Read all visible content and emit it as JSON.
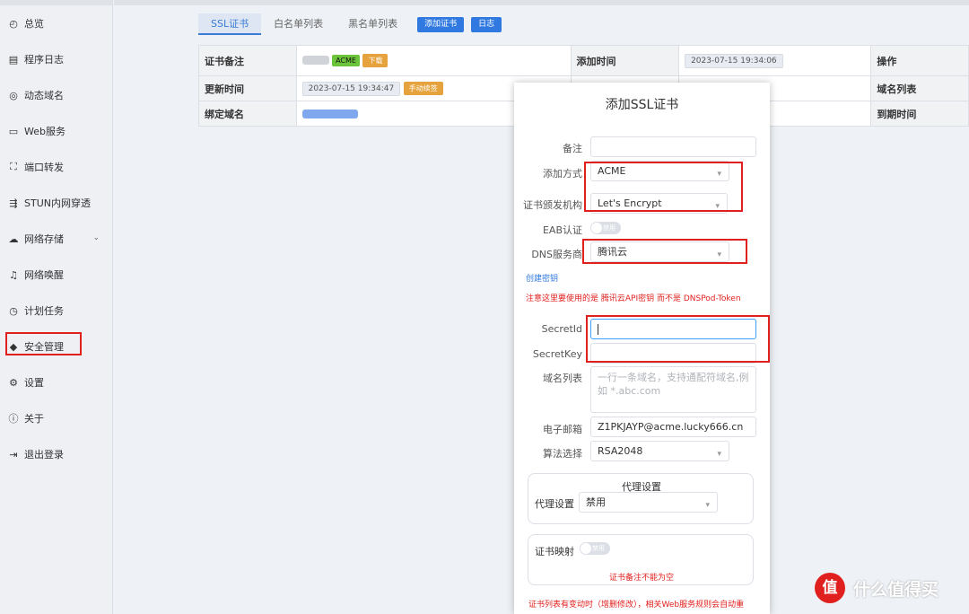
{
  "sidebar": {
    "items": [
      {
        "label": "总览",
        "icon": "dashboard-icon"
      },
      {
        "label": "程序日志",
        "icon": "log-icon"
      },
      {
        "label": "动态域名",
        "icon": "ddns-icon"
      },
      {
        "label": "Web服务",
        "icon": "web-icon"
      },
      {
        "label": "端口转发",
        "icon": "port-forward-icon"
      },
      {
        "label": "STUN内网穿透",
        "icon": "stun-icon"
      },
      {
        "label": "网络存储",
        "icon": "cloud-storage-icon"
      },
      {
        "label": "网络唤醒",
        "icon": "bell-icon"
      },
      {
        "label": "计划任务",
        "icon": "clock-icon"
      },
      {
        "label": "安全管理",
        "icon": "shield-icon"
      },
      {
        "label": "设置",
        "icon": "gear-icon"
      },
      {
        "label": "关于",
        "icon": "info-icon"
      },
      {
        "label": "退出登录",
        "icon": "logout-icon"
      }
    ]
  },
  "tabs": {
    "ssl": "SSL证书",
    "whitelist": "白名单列表",
    "blacklist": "黑名单列表",
    "add_cert": "添加证书",
    "log": "日志"
  },
  "table": {
    "remark_label": "证书备注",
    "acme_tag": "ACME",
    "download_tag": "下载",
    "add_time_label": "添加时间",
    "add_time_value": "2023-07-15 19:34:06",
    "action_label": "操作",
    "update_time_label": "更新时间",
    "update_time_value": "2023-07-15 19:34:47",
    "manual_btn": "手动续签",
    "domain_list_label": "域名列表",
    "bound_domain_label": "绑定域名",
    "expire_label": "到期时间"
  },
  "dialog": {
    "title": "添加SSL证书",
    "remark_label": "备注",
    "remark_value": "",
    "method_label": "添加方式",
    "method_value": "ACME",
    "ca_label": "证书颁发机构",
    "ca_value": "Let's Encrypt",
    "eab_label": "EAB认证",
    "eab_switch": "禁用",
    "dns_label": "DNS服务商",
    "dns_value": "腾讯云",
    "create_key_link": "创建密钥",
    "warning": "注意这里要使用的是 腾讯云API密钥 而不是 DNSPod-Token",
    "secretid_label": "SecretId",
    "secretid_value": "",
    "secretkey_label": "SecretKey",
    "secretkey_value": "",
    "domains_label": "域名列表",
    "domains_placeholder": "一行一条域名，支持通配符域名,例如 *.abc.com",
    "email_label": "电子邮箱",
    "email_value": "Z1PKJAYP@acme.lucky666.cn",
    "algo_label": "算法选择",
    "algo_value": "RSA2048",
    "proxy_group_title": "代理设置",
    "proxy_label": "代理设置",
    "proxy_value": "禁用",
    "mapping_label": "证书映射",
    "mapping_switch": "禁用",
    "mapping_error": "证书备注不能为空",
    "bottom_note": "证书列表有变动时（增删修改），相关Web服务规则会自动重"
  },
  "watermark": {
    "logo": "值",
    "text": "什么值得买"
  },
  "colors": {
    "accent": "#2f79e0",
    "highlight": "#e0201e",
    "tag_green": "#6bc43a",
    "tag_orange": "#e6a23c"
  }
}
